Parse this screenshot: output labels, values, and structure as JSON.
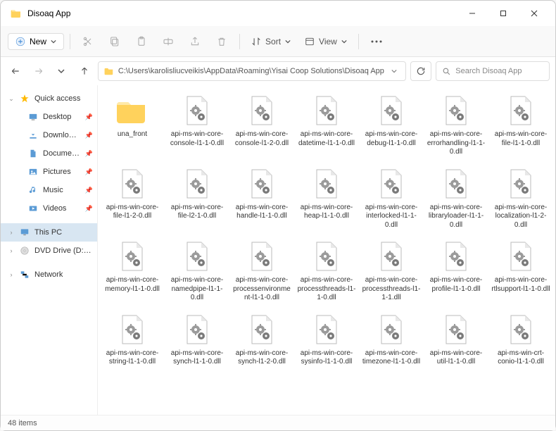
{
  "window": {
    "title": "Disoaq App"
  },
  "toolbar": {
    "new_label": "New",
    "sort_label": "Sort",
    "view_label": "View"
  },
  "address": {
    "path": "C:\\Users\\karolisliucveikis\\AppData\\Roaming\\Yisai Coop Solutions\\Disoaq App"
  },
  "search": {
    "placeholder": "Search Disoaq App"
  },
  "sidebar": {
    "quick": {
      "label": "Quick access"
    },
    "items": [
      {
        "label": "Desktop"
      },
      {
        "label": "Downloads"
      },
      {
        "label": "Documents"
      },
      {
        "label": "Pictures"
      },
      {
        "label": "Music"
      },
      {
        "label": "Videos"
      }
    ],
    "thispc": {
      "label": "This PC"
    },
    "dvd": {
      "label": "DVD Drive (D:) CCCC"
    },
    "network": {
      "label": "Network"
    }
  },
  "files": [
    {
      "type": "folder",
      "name": "una_front"
    },
    {
      "type": "dll",
      "name": "api-ms-win-core-console-l1-1-0.dll"
    },
    {
      "type": "dll",
      "name": "api-ms-win-core-console-l1-2-0.dll"
    },
    {
      "type": "dll",
      "name": "api-ms-win-core-datetime-l1-1-0.dll"
    },
    {
      "type": "dll",
      "name": "api-ms-win-core-debug-l1-1-0.dll"
    },
    {
      "type": "dll",
      "name": "api-ms-win-core-errorhandling-l1-1-0.dll"
    },
    {
      "type": "dll",
      "name": "api-ms-win-core-file-l1-1-0.dll"
    },
    {
      "type": "dll",
      "name": "api-ms-win-core-file-l1-2-0.dll"
    },
    {
      "type": "dll",
      "name": "api-ms-win-core-file-l2-1-0.dll"
    },
    {
      "type": "dll",
      "name": "api-ms-win-core-handle-l1-1-0.dll"
    },
    {
      "type": "dll",
      "name": "api-ms-win-core-heap-l1-1-0.dll"
    },
    {
      "type": "dll",
      "name": "api-ms-win-core-interlocked-l1-1-0.dll"
    },
    {
      "type": "dll",
      "name": "api-ms-win-core-libraryloader-l1-1-0.dll"
    },
    {
      "type": "dll",
      "name": "api-ms-win-core-localization-l1-2-0.dll"
    },
    {
      "type": "dll",
      "name": "api-ms-win-core-memory-l1-1-0.dll"
    },
    {
      "type": "dll",
      "name": "api-ms-win-core-namedpipe-l1-1-0.dll"
    },
    {
      "type": "dll",
      "name": "api-ms-win-core-processenvironment-l1-1-0.dll"
    },
    {
      "type": "dll",
      "name": "api-ms-win-core-processthreads-l1-1-0.dll"
    },
    {
      "type": "dll",
      "name": "api-ms-win-core-processthreads-l1-1-1.dll"
    },
    {
      "type": "dll",
      "name": "api-ms-win-core-profile-l1-1-0.dll"
    },
    {
      "type": "dll",
      "name": "api-ms-win-core-rtlsupport-l1-1-0.dll"
    },
    {
      "type": "dll",
      "name": "api-ms-win-core-string-l1-1-0.dll"
    },
    {
      "type": "dll",
      "name": "api-ms-win-core-synch-l1-1-0.dll"
    },
    {
      "type": "dll",
      "name": "api-ms-win-core-synch-l1-2-0.dll"
    },
    {
      "type": "dll",
      "name": "api-ms-win-core-sysinfo-l1-1-0.dll"
    },
    {
      "type": "dll",
      "name": "api-ms-win-core-timezone-l1-1-0.dll"
    },
    {
      "type": "dll",
      "name": "api-ms-win-core-util-l1-1-0.dll"
    },
    {
      "type": "dll",
      "name": "api-ms-win-crt-conio-l1-1-0.dll"
    }
  ],
  "status": {
    "count": "48 items"
  }
}
